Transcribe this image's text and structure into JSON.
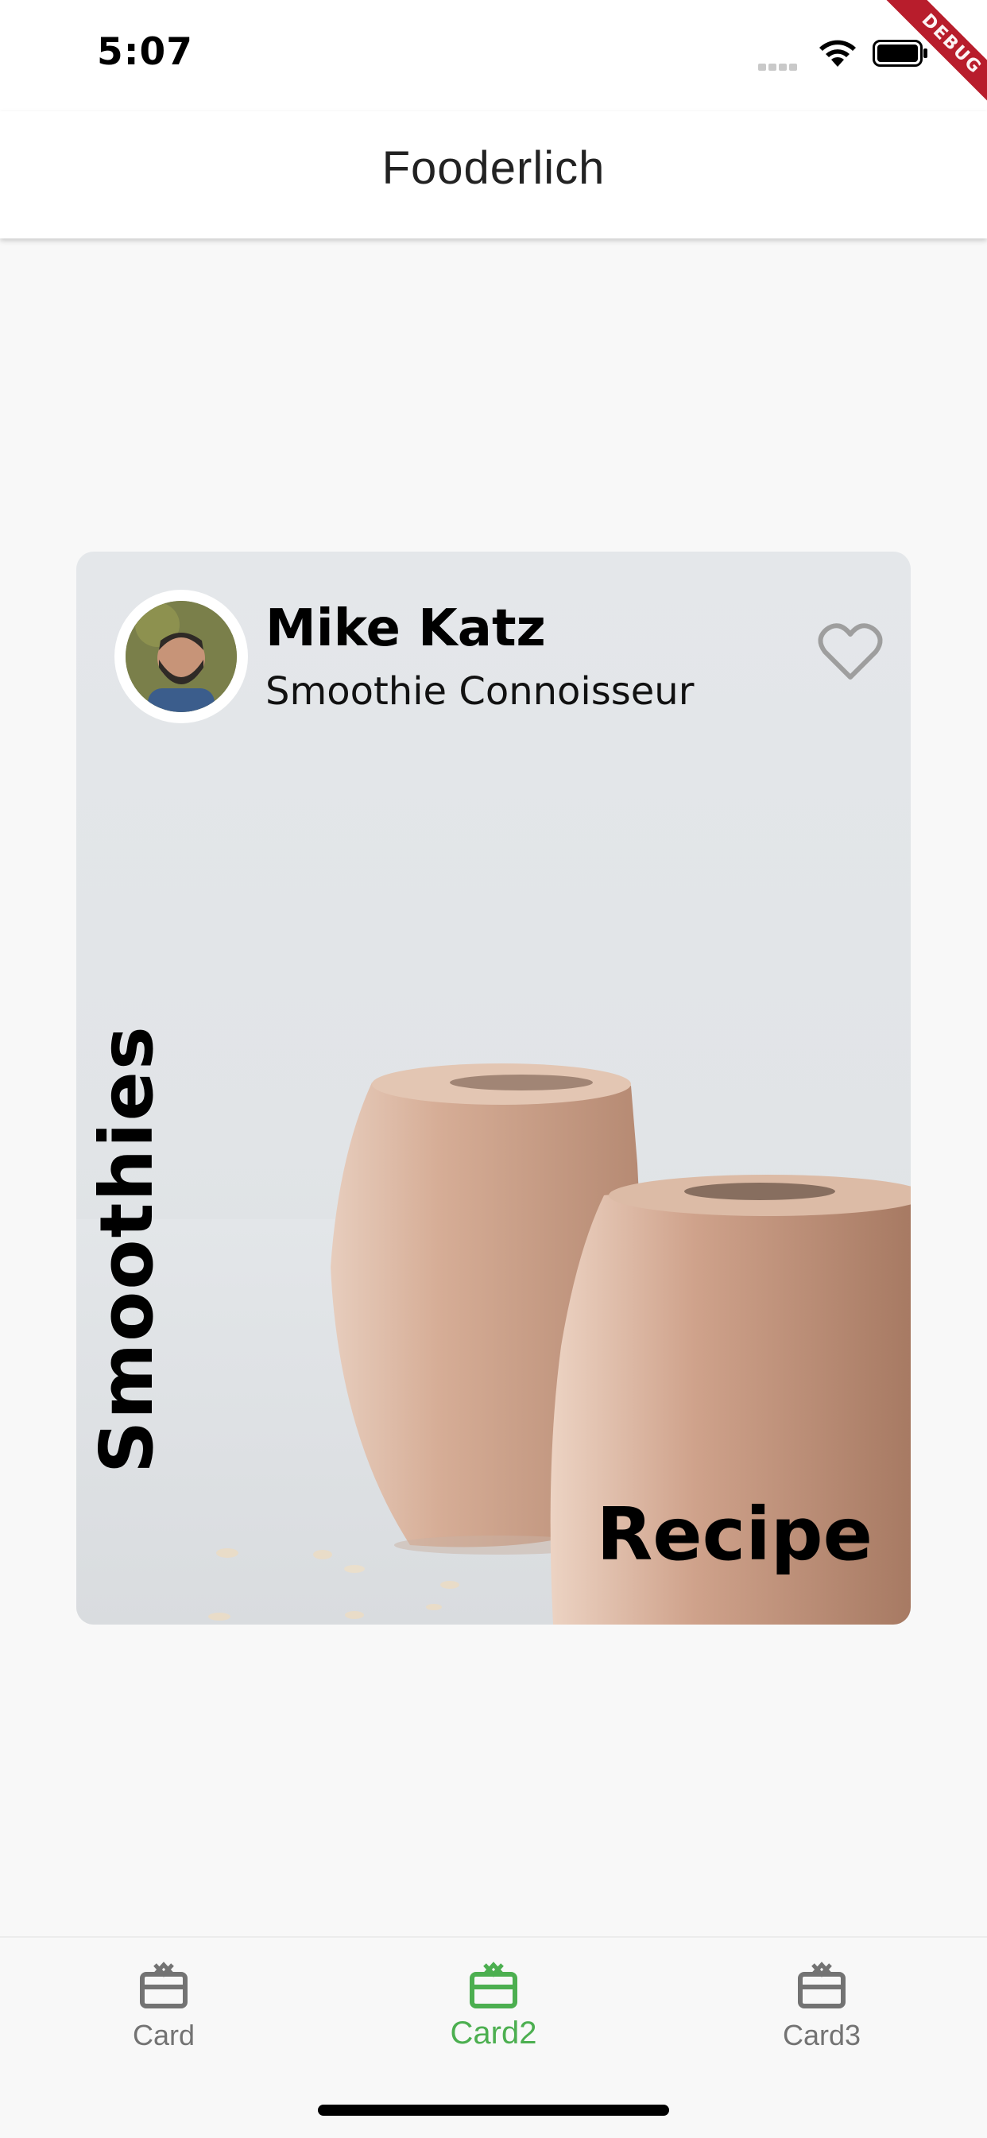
{
  "status_bar": {
    "time": "5:07",
    "debug_label": "DEBUG",
    "icons": [
      "signal-icon",
      "wifi-icon",
      "battery-icon"
    ]
  },
  "app_bar": {
    "title": "Fooderlich"
  },
  "card": {
    "author_name": "Mike Katz",
    "author_title": "Smoothie Connoisseur",
    "vertical_title": "Smoothies",
    "recipe_label": "Recipe",
    "favorite_icon": "heart-outline-icon"
  },
  "bottom_nav": {
    "items": [
      {
        "label": "Card",
        "icon": "card-giftcard-icon"
      },
      {
        "label": "Card2",
        "icon": "card-giftcard-icon"
      },
      {
        "label": "Card3",
        "icon": "card-giftcard-icon"
      }
    ],
    "selected_index": 1
  },
  "colors": {
    "accent": "#4caf50",
    "inactive": "#737373",
    "debug_banner": "#b81d2c"
  }
}
